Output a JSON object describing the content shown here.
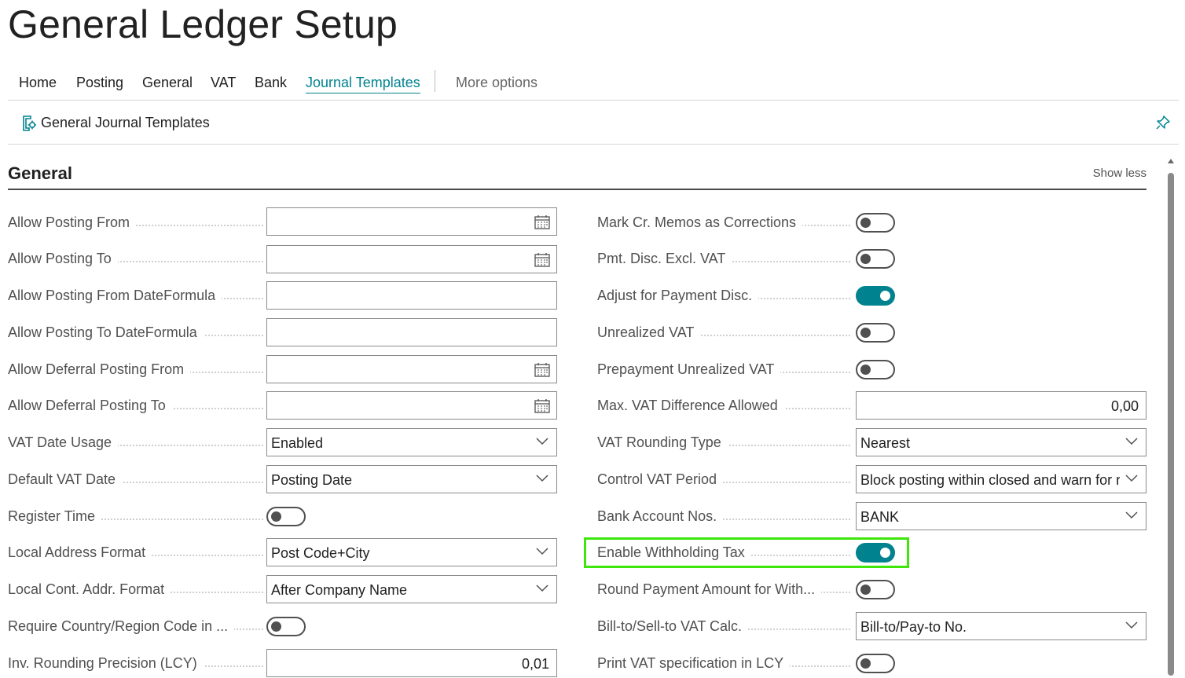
{
  "page": {
    "title": "General Ledger Setup"
  },
  "action_bar": {
    "tabs": [
      {
        "label": "Home"
      },
      {
        "label": "Posting"
      },
      {
        "label": "General"
      },
      {
        "label": "VAT"
      },
      {
        "label": "Bank"
      },
      {
        "label": "Journal Templates",
        "active": true
      }
    ],
    "more_options": "More options"
  },
  "sub_bar": {
    "templates_label": "General Journal Templates",
    "pin_icon": "pin-icon"
  },
  "section": {
    "title": "General",
    "toggle_label": "Show less"
  },
  "left_fields": [
    {
      "label": "Allow Posting From",
      "type": "date",
      "value": ""
    },
    {
      "label": "Allow Posting To",
      "type": "date",
      "value": ""
    },
    {
      "label": "Allow Posting From DateFormula",
      "type": "text",
      "value": ""
    },
    {
      "label": "Allow Posting To DateFormula",
      "type": "text",
      "value": ""
    },
    {
      "label": "Allow Deferral Posting From",
      "type": "date",
      "value": ""
    },
    {
      "label": "Allow Deferral Posting To",
      "type": "date",
      "value": ""
    },
    {
      "label": "VAT Date Usage",
      "type": "select",
      "value": "Enabled"
    },
    {
      "label": "Default VAT Date",
      "type": "select",
      "value": "Posting Date"
    },
    {
      "label": "Register Time",
      "type": "toggle",
      "value": false
    },
    {
      "label": "Local Address Format",
      "type": "select",
      "value": "Post Code+City"
    },
    {
      "label": "Local Cont. Addr. Format",
      "type": "select",
      "value": "After Company Name"
    },
    {
      "label": "Require Country/Region Code in ...",
      "type": "toggle",
      "value": false
    },
    {
      "label": "Inv. Rounding Precision (LCY)",
      "type": "number",
      "value": "0,01"
    }
  ],
  "right_fields": [
    {
      "label": "Mark Cr. Memos as Corrections",
      "type": "toggle",
      "value": false
    },
    {
      "label": "Pmt. Disc. Excl. VAT",
      "type": "toggle",
      "value": false
    },
    {
      "label": "Adjust for Payment Disc.",
      "type": "toggle",
      "value": true
    },
    {
      "label": "Unrealized VAT",
      "type": "toggle",
      "value": false
    },
    {
      "label": "Prepayment Unrealized VAT",
      "type": "toggle",
      "value": false
    },
    {
      "label": "Max. VAT Difference Allowed",
      "type": "number",
      "value": "0,00"
    },
    {
      "label": "VAT Rounding Type",
      "type": "select",
      "value": "Nearest"
    },
    {
      "label": "Control VAT Period",
      "type": "select",
      "value": "Block posting within closed and warn for released"
    },
    {
      "label": "Bank Account Nos.",
      "type": "select",
      "value": "BANK"
    },
    {
      "label": "Enable Withholding Tax",
      "type": "toggle",
      "value": true,
      "highlighted": true
    },
    {
      "label": "Round Payment Amount for With...",
      "type": "toggle",
      "value": false
    },
    {
      "label": "Bill-to/Sell-to VAT Calc.",
      "type": "select",
      "value": "Bill-to/Pay-to No."
    },
    {
      "label": "Print VAT specification in LCY",
      "type": "toggle",
      "value": false
    }
  ],
  "colors": {
    "accent": "#00838f",
    "highlight": "#3ee60b",
    "label": "#505050"
  }
}
